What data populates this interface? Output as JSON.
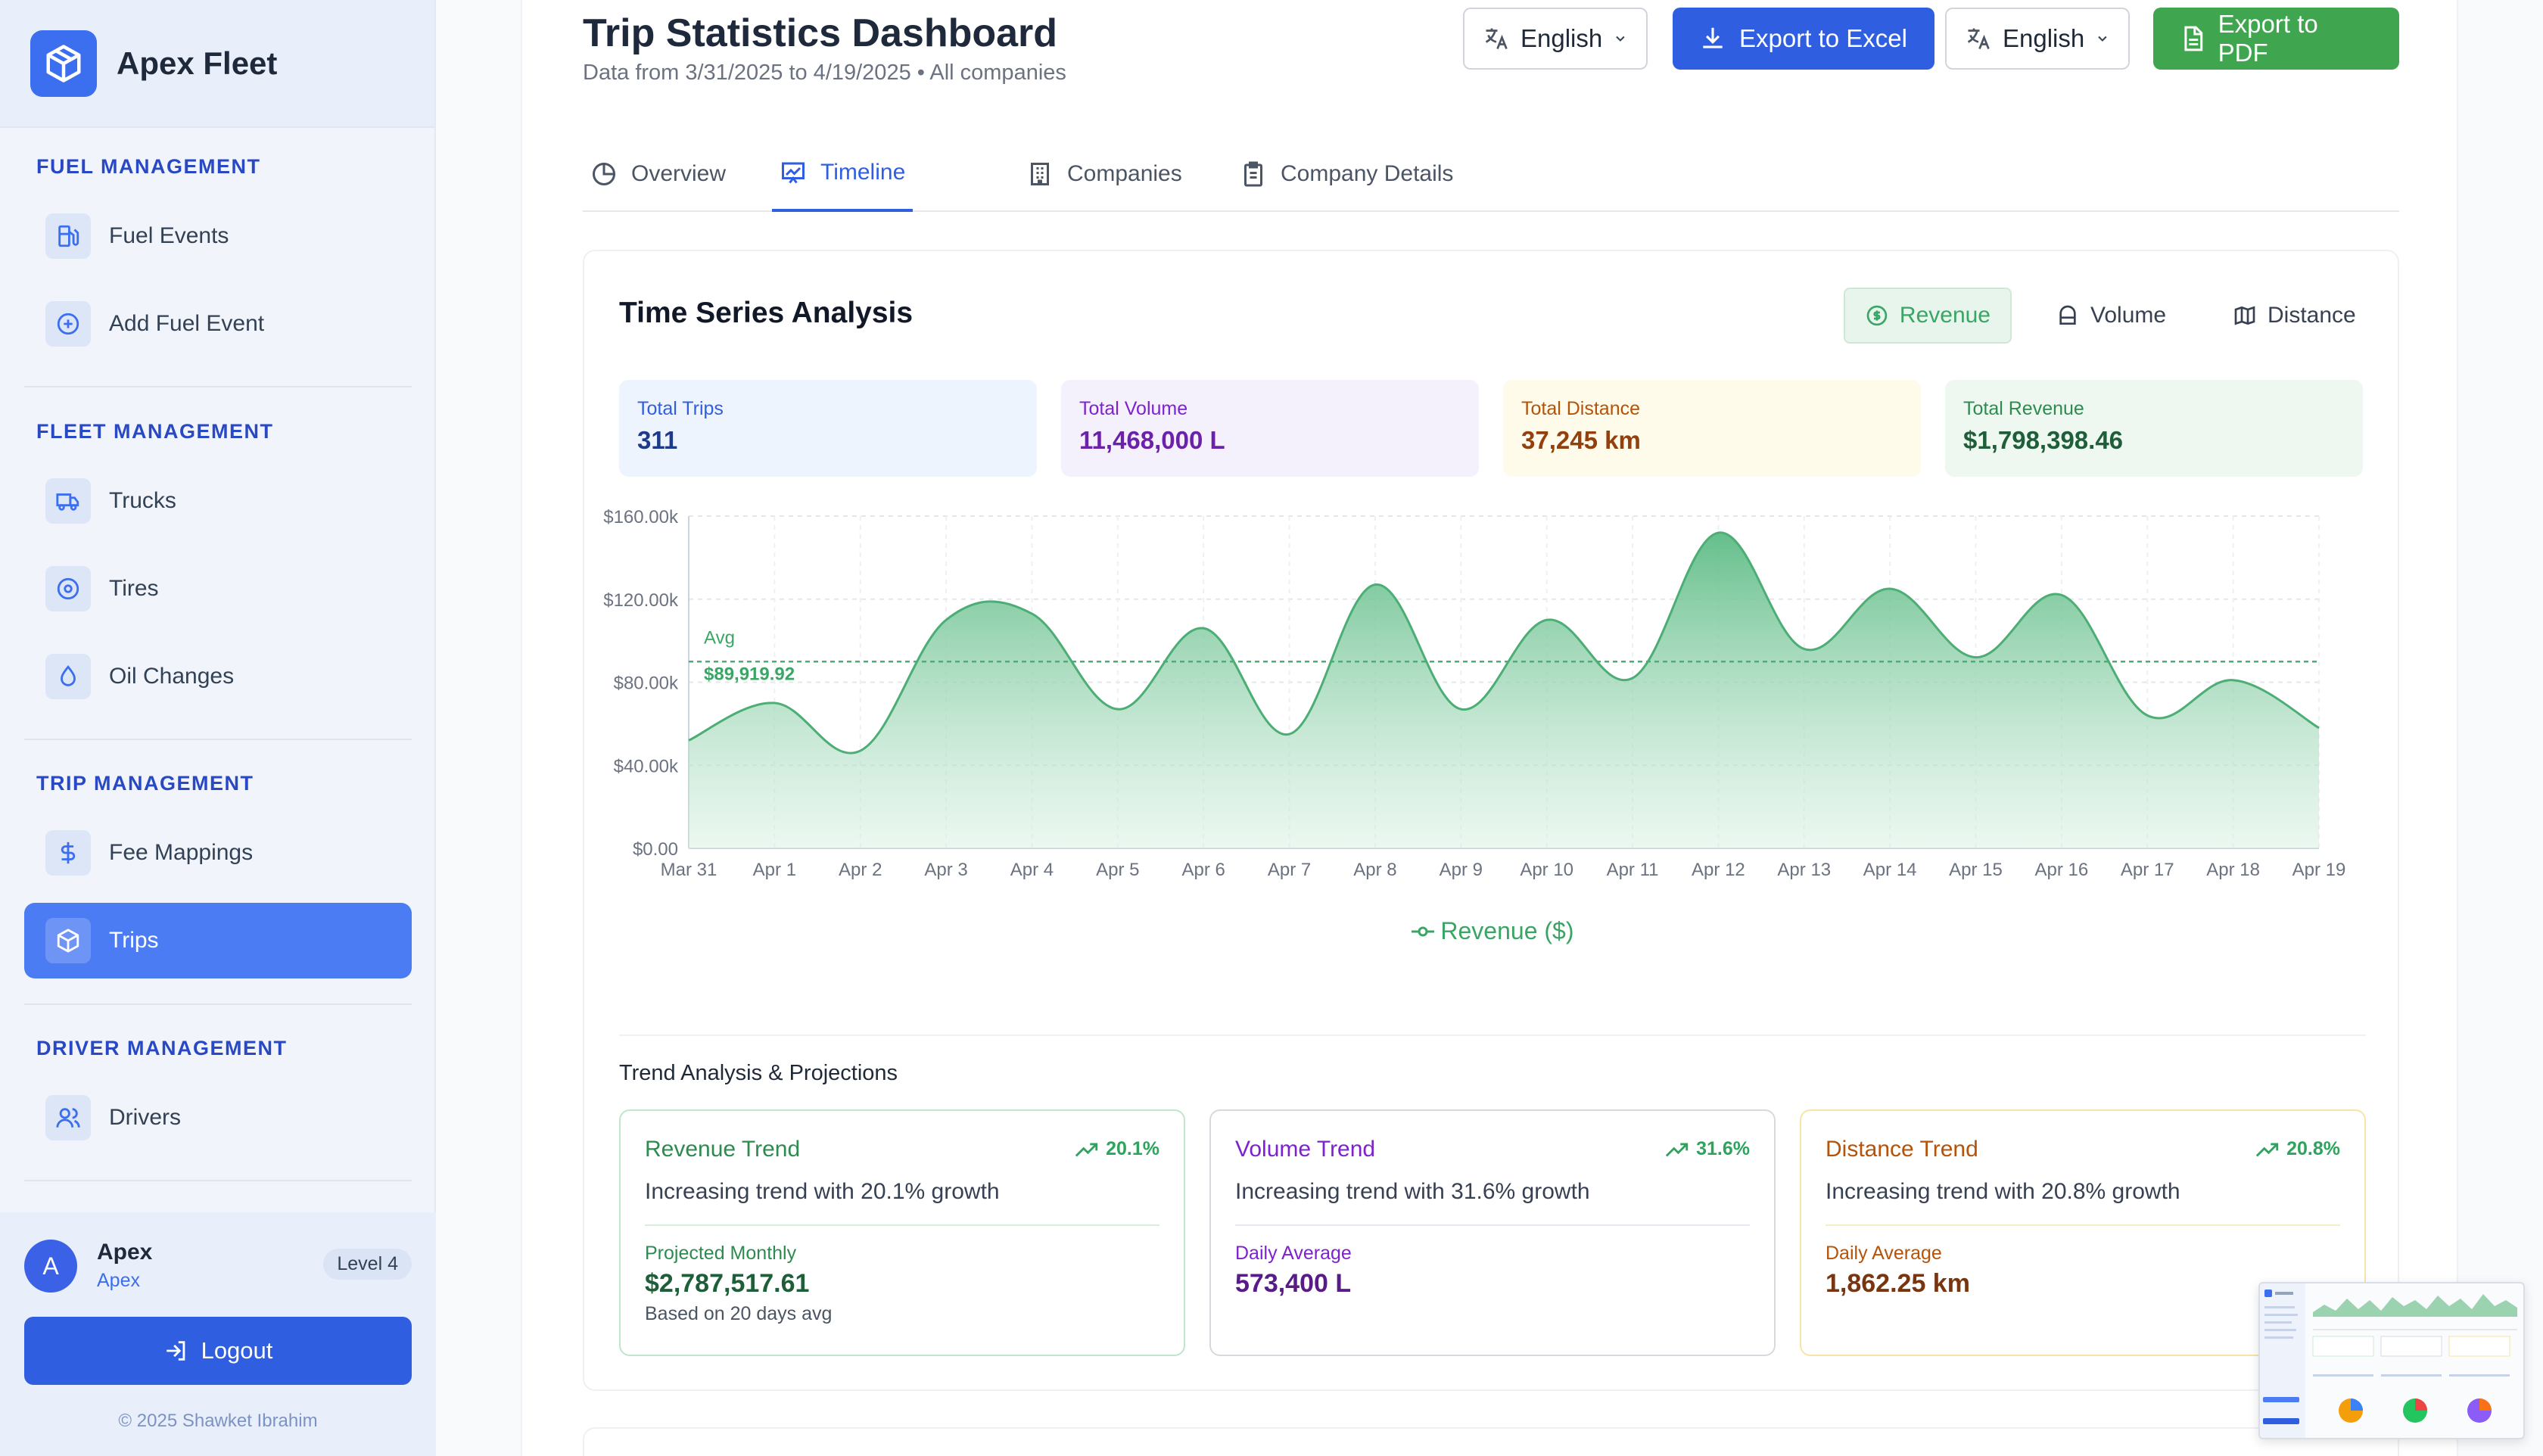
{
  "app": {
    "name": "Apex Fleet"
  },
  "sidebar": {
    "sections": [
      {
        "title": "FUEL MANAGEMENT",
        "items": [
          {
            "label": "Fuel Events",
            "icon": "fuel-pump-icon"
          },
          {
            "label": "Add Fuel Event",
            "icon": "plus-circle-icon"
          }
        ]
      },
      {
        "title": "FLEET MANAGEMENT",
        "items": [
          {
            "label": "Trucks",
            "icon": "truck-icon"
          },
          {
            "label": "Tires",
            "icon": "tire-icon"
          },
          {
            "label": "Oil Changes",
            "icon": "droplet-icon"
          }
        ]
      },
      {
        "title": "TRIP MANAGEMENT",
        "items": [
          {
            "label": "Fee Mappings",
            "icon": "dollar-icon"
          },
          {
            "label": "Trips",
            "icon": "package-icon",
            "active": true
          }
        ]
      },
      {
        "title": "DRIVER MANAGEMENT",
        "items": [
          {
            "label": "Drivers",
            "icon": "users-icon"
          }
        ]
      }
    ]
  },
  "user": {
    "initial": "A",
    "name": "Apex",
    "role": "Apex",
    "level": "Level 4",
    "logout_label": "Logout",
    "copyright": "© 2025 Shawket Ibrahim"
  },
  "header": {
    "title": "Trip Statistics Dashboard",
    "subtitle": "Data from 3/31/2025 to 4/19/2025 • All companies",
    "lang1": "English",
    "export_excel": "Export to Excel",
    "lang2": "English",
    "export_pdf": "Export to PDF"
  },
  "tabs": [
    {
      "label": "Overview",
      "icon": "pie-icon"
    },
    {
      "label": "Timeline",
      "icon": "chart-icon",
      "active": true
    },
    {
      "label": "Companies",
      "icon": "building-icon"
    },
    {
      "label": "Company Details",
      "icon": "clipboard-icon"
    }
  ],
  "card": {
    "title": "Time Series Analysis",
    "metrics": [
      {
        "label": "Revenue",
        "active": true
      },
      {
        "label": "Volume"
      },
      {
        "label": "Distance"
      }
    ],
    "stats": [
      {
        "label": "Total Trips",
        "value": "311"
      },
      {
        "label": "Total Volume",
        "value": "11,468,000 L"
      },
      {
        "label": "Total Distance",
        "value": "37,245 km"
      },
      {
        "label": "Total Revenue",
        "value": "$1,798,398.46"
      }
    ],
    "avg_label": "Avg",
    "avg_value": "$89,919.92",
    "legend": "Revenue ($)",
    "trend_heading": "Trend Analysis & Projections",
    "trends": [
      {
        "title": "Revenue Trend",
        "pct": "20.1%",
        "desc": "Increasing trend with 20.1% growth",
        "sub": "Projected Monthly",
        "value": "$2,787,517.61",
        "note": "Based on 20 days avg"
      },
      {
        "title": "Volume Trend",
        "pct": "31.6%",
        "desc": "Increasing trend with 31.6% growth",
        "sub": "Daily Average",
        "value": "573,400 L",
        "note": ""
      },
      {
        "title": "Distance Trend",
        "pct": "20.8%",
        "desc": "Increasing trend with 20.8% growth",
        "sub": "Daily Average",
        "value": "1,862.25 km",
        "note": ""
      }
    ]
  },
  "colors": {
    "accent": "#2f5fe0",
    "green": "#3aa565",
    "purple": "#7e22ce",
    "amber": "#b45309"
  },
  "chart_data": {
    "type": "area",
    "title": "Time Series Analysis",
    "x": [
      "Mar 31",
      "Apr 1",
      "Apr 2",
      "Apr 3",
      "Apr 4",
      "Apr 5",
      "Apr 6",
      "Apr 7",
      "Apr 8",
      "Apr 9",
      "Apr 10",
      "Apr 11",
      "Apr 12",
      "Apr 13",
      "Apr 14",
      "Apr 15",
      "Apr 16",
      "Apr 17",
      "Apr 18",
      "Apr 19"
    ],
    "series": [
      {
        "name": "Revenue ($)",
        "values": [
          52000,
          70000,
          47000,
          110000,
          113000,
          67000,
          106000,
          55000,
          127000,
          67000,
          110000,
          82000,
          152000,
          96000,
          125000,
          92000,
          122000,
          64000,
          81000,
          58000
        ]
      }
    ],
    "average": 89919.92,
    "yticks": [
      "$0.00",
      "$40.00k",
      "$80.00k",
      "$120.00k",
      "$160.00k"
    ],
    "ylim": [
      0,
      160000
    ],
    "grid": true
  }
}
